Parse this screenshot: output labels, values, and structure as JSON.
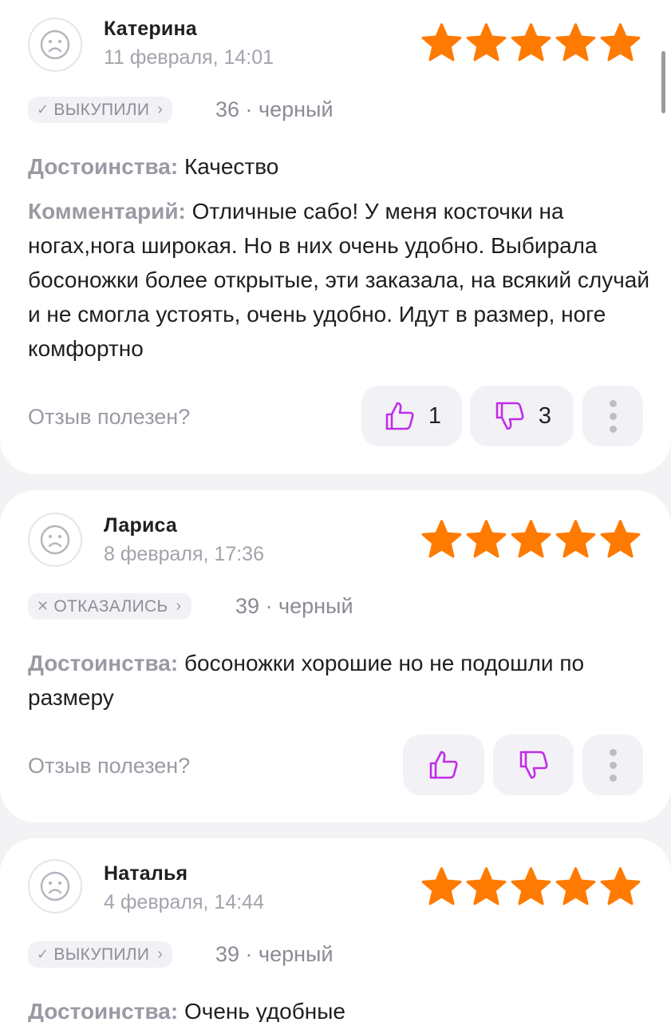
{
  "colors": {
    "star": "#ff7a00",
    "vote_icon": "#c22ce8",
    "muted": "#9a9aa4",
    "card": "#ffffff",
    "background": "#f3f3f6"
  },
  "icons": {
    "avatar": "sad-face-icon",
    "rating": "star-icon",
    "like": "thumbs-up-icon",
    "dislike": "thumbs-down-icon",
    "more": "more-vertical-icon"
  },
  "helpful_question": "Отзыв полезен?",
  "reviews": [
    {
      "author": "Катерина",
      "date": "11 февраля, 14:01",
      "rating": 5,
      "status_mark": "✓",
      "status": "ВЫКУПИЛИ",
      "variant": "36 · черный",
      "fields": [
        {
          "label": "Достоинства:",
          "text": "Качество"
        },
        {
          "label": "Комментарий:",
          "text": "Отличные сабо! У меня косточки на ногах,нога широкая.  Но в них очень удобно. Выбирала босоножки более открытые, эти заказала, на всякий случай и не смогла устоять, очень удобно. Идут в размер, ноге комфортно"
        }
      ],
      "likes": "1",
      "dislikes": "3"
    },
    {
      "author": "Лариса",
      "date": "8 февраля, 17:36",
      "rating": 5,
      "status_mark": "✕",
      "status": "ОТКАЗАЛИСЬ",
      "variant": "39 · черный",
      "fields": [
        {
          "label": "Достоинства:",
          "text": "босоножки хорошие но не подошли по размеру"
        }
      ],
      "likes": "",
      "dislikes": ""
    },
    {
      "author": "Наталья",
      "date": "4 февраля, 14:44",
      "rating": 5,
      "status_mark": "✓",
      "status": "ВЫКУПИЛИ",
      "variant": "39 · черный",
      "fields": [
        {
          "label": "Достоинства:",
          "text": "Очень удобные"
        }
      ]
    }
  ]
}
